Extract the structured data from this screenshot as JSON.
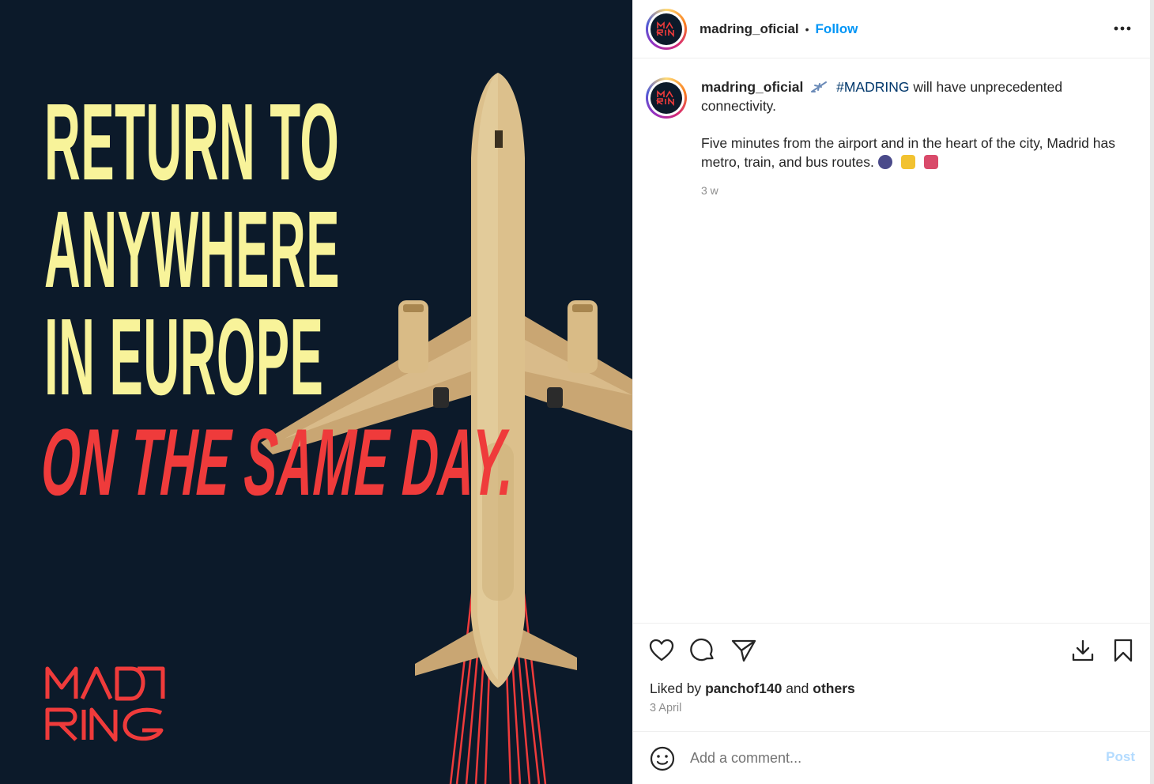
{
  "post_image": {
    "headline_lines": [
      "RETURN TO",
      "ANYWHERE",
      "IN EUROPE"
    ],
    "headline_accent": "ON THE SAME DAY.",
    "colors": {
      "background": "#0c1a2a",
      "headline": "#f8f39a",
      "accent": "#ef3b3b",
      "plane": "#d7b988"
    }
  },
  "header": {
    "username": "madring_oficial",
    "separator": "•",
    "follow_label": "Follow",
    "more_icon": "more-horizontal-icon"
  },
  "caption": {
    "username": "madring_oficial",
    "hashtag": "#MADRING",
    "line1_rest": "will have unprecedented connectivity.",
    "paragraph2": "Five minutes from the airport and in the heart of the city, Madrid has metro, train, and bus routes.",
    "time_ago": "3 w"
  },
  "actions": {
    "icons": [
      "heart-icon",
      "comment-icon",
      "share-icon",
      "download-icon",
      "bookmark-icon"
    ],
    "liked_by_prefix": "Liked by",
    "liked_by_user": "panchof140",
    "liked_by_and": "and",
    "liked_by_others": "others",
    "date": "3 April"
  },
  "comment": {
    "placeholder": "Add a comment...",
    "post_label": "Post"
  },
  "colors": {
    "link_blue": "#0095f6",
    "hashtag": "#00376b",
    "post_disabled": "#b3dbff"
  }
}
